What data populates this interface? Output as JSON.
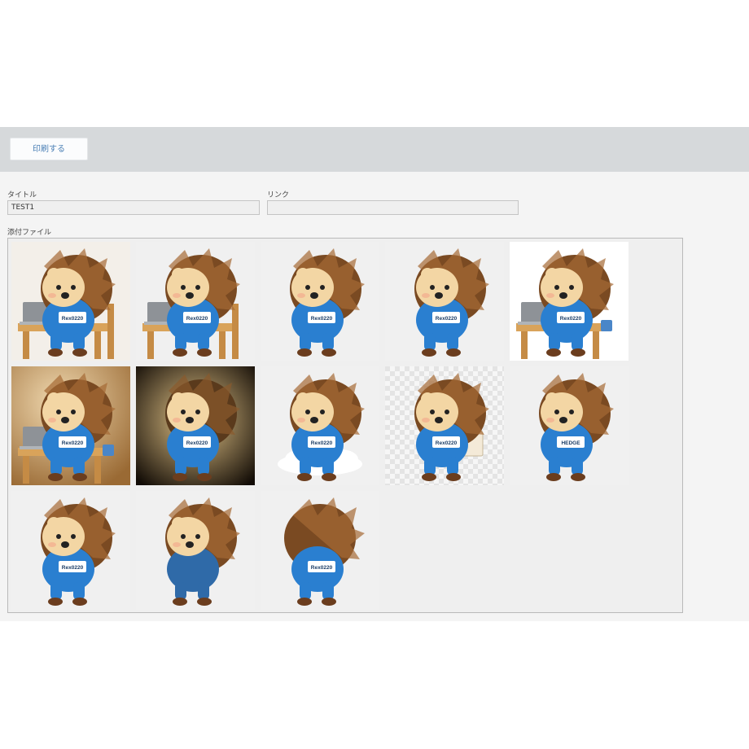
{
  "toolbar": {
    "print_label": "印刷する"
  },
  "form": {
    "title_label": "タイトル",
    "title_value": "TEST1",
    "link_label": "リンク",
    "link_value": "",
    "attachments_label": "添付ファイル"
  },
  "attachments": [
    {
      "badge": "Rex0220",
      "bg": "#f3efe9",
      "pose": "laptop"
    },
    {
      "badge": "Rex0220",
      "bg": "#f0f0f0",
      "pose": "laptop"
    },
    {
      "badge": "Rex0220",
      "bg": "#f0f0f0",
      "pose": "walk"
    },
    {
      "badge": "Rex0220",
      "bg": "#f0f0f0",
      "pose": "walk"
    },
    {
      "badge": "Rex0220",
      "bg": "#ffffff",
      "pose": "laptop-mug"
    },
    {
      "badge": "Rex0220",
      "bg": "#c9a26a",
      "pose": "laptop-mug"
    },
    {
      "badge": "Rex0220",
      "bg": "#3a2a18",
      "pose": "walk"
    },
    {
      "badge": "Rex0220",
      "bg": "#f0f0f0",
      "pose": "cloud"
    },
    {
      "badge": "Rex0220",
      "bg": "#e9e9e9",
      "pose": "point"
    },
    {
      "badge": "HEDGE",
      "bg": "#f0f0f0",
      "pose": "run"
    },
    {
      "badge": "Rex0220",
      "bg": "#f0f0f0",
      "pose": "punch"
    },
    {
      "badge": "",
      "bg": "#f0f0f0",
      "pose": "punch-dark"
    },
    {
      "badge": "Rex0220",
      "bg": "#f0f0f0",
      "pose": "back"
    }
  ]
}
